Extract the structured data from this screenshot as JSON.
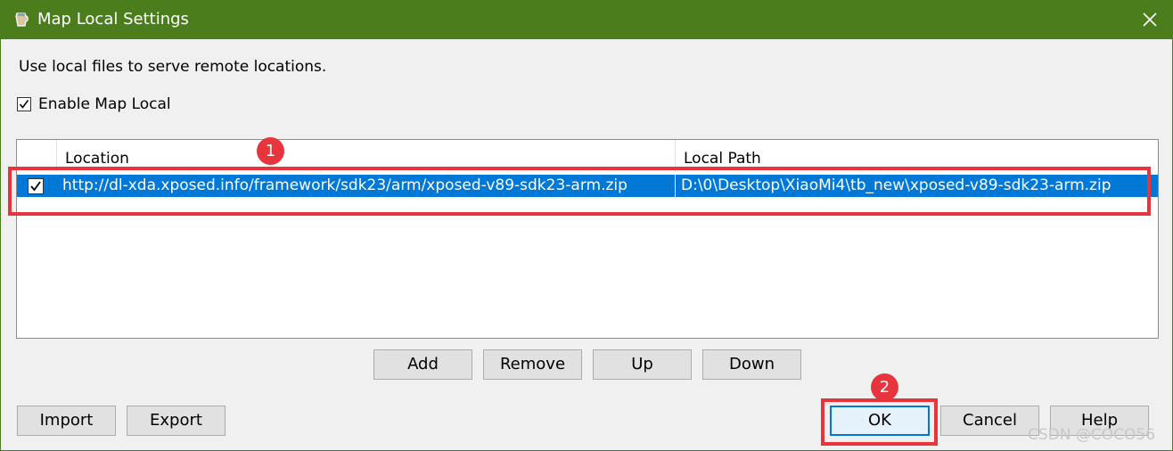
{
  "window": {
    "title": "Map Local Settings"
  },
  "description": "Use local files to serve remote locations.",
  "enable": {
    "label": "Enable Map Local",
    "checked": true
  },
  "table": {
    "columns": [
      "Location",
      "Local Path"
    ],
    "rows": [
      {
        "checked": true,
        "location": "http://dl-xda.xposed.info/framework/sdk23/arm/xposed-v89-sdk23-arm.zip",
        "local_path": "D:\\0\\Desktop\\XiaoMi4\\tb_new\\xposed-v89-sdk23-arm.zip"
      }
    ]
  },
  "buttons": {
    "add": "Add",
    "remove": "Remove",
    "up": "Up",
    "down": "Down",
    "import": "Import",
    "export": "Export",
    "ok": "OK",
    "cancel": "Cancel",
    "help": "Help"
  },
  "annotations": {
    "badge1": "1",
    "badge2": "2"
  },
  "watermark": "CSDN @COCO56",
  "colors": {
    "titlebar": "#4c7d1c",
    "selection": "#0078d7",
    "annotation": "#e8353d"
  }
}
